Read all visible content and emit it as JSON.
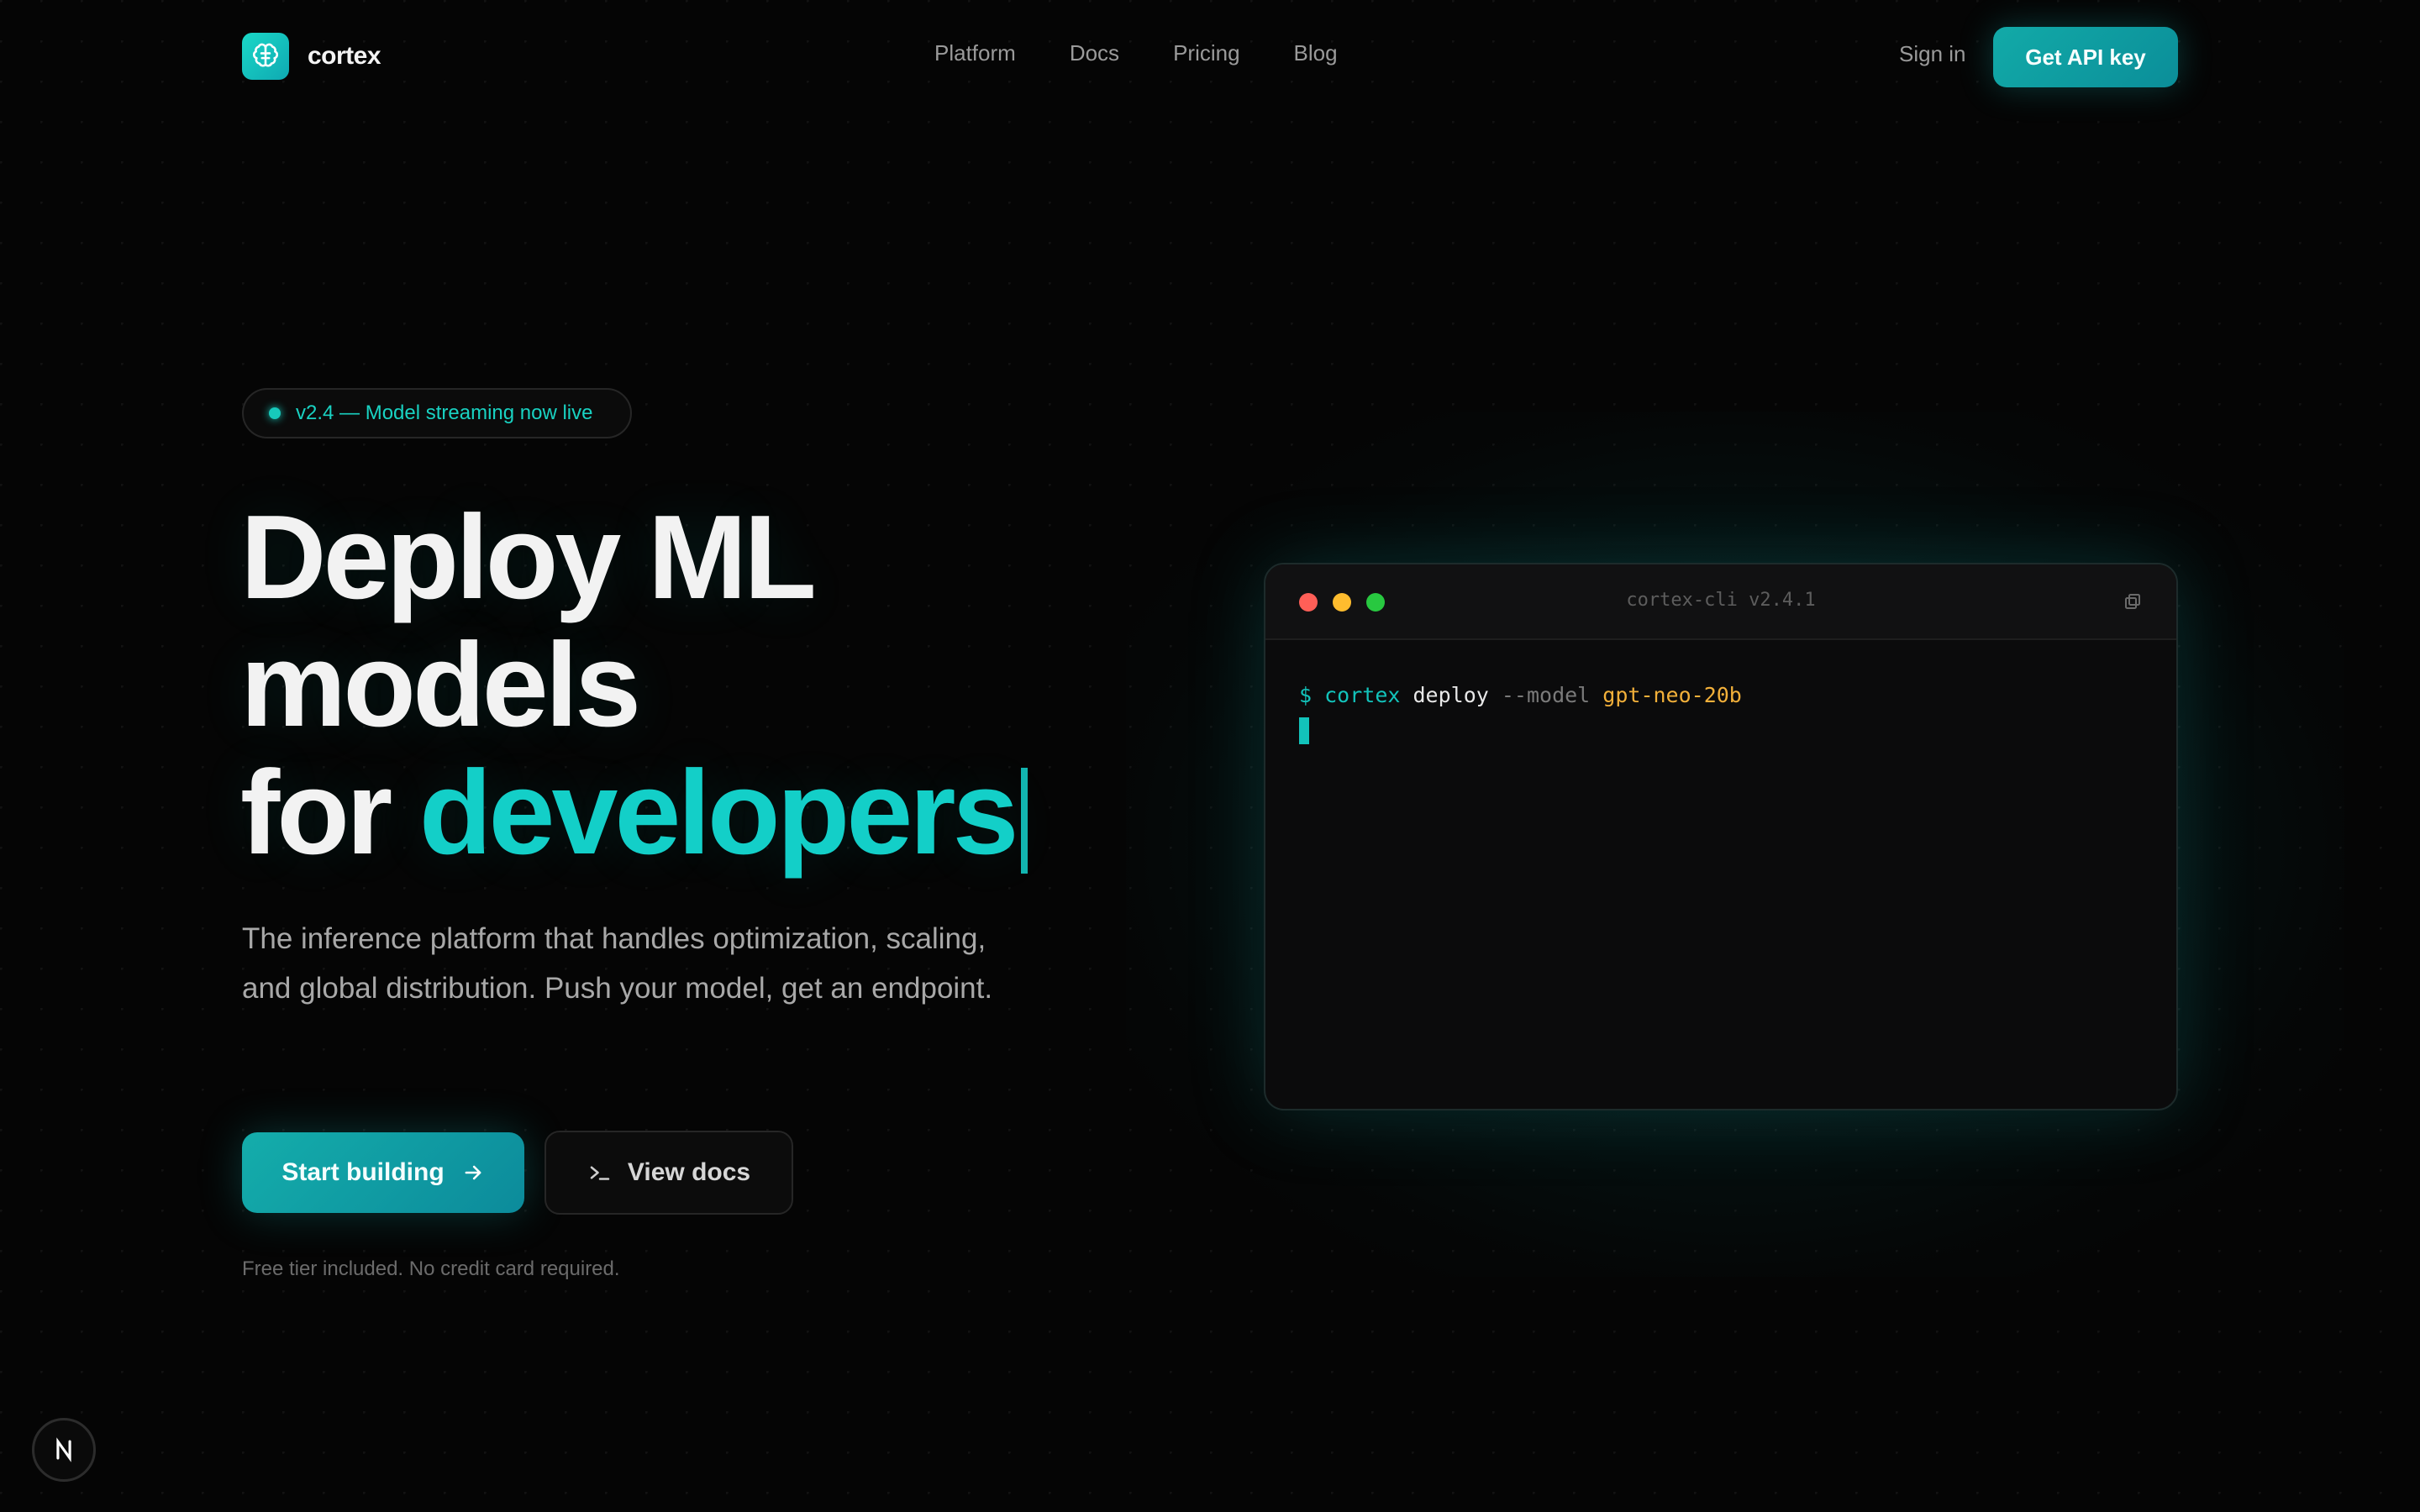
{
  "brand": {
    "name": "cortex",
    "logo_icon": "brain-icon",
    "accent": "#13cfc8"
  },
  "nav": {
    "links": [
      "Platform",
      "Docs",
      "Pricing",
      "Blog"
    ],
    "sign_in": "Sign in",
    "api_key": "Get API key"
  },
  "hero": {
    "badge": "v2.4 — Model streaming now live",
    "headline_line1": "Deploy ML",
    "headline_line2": "models",
    "headline_line3_prefix": "for ",
    "headline_line3_accent": "developers",
    "subtitle": "The inference platform that handles optimization, scaling, and global distribution. Push your model, get an endpoint.",
    "cta_primary": "Start building",
    "cta_secondary": "View docs",
    "fine_print": "Free tier included. No credit card required."
  },
  "terminal": {
    "title": "cortex-cli v2.4.1",
    "prompt": "$",
    "command": "cortex",
    "subcommand": "deploy",
    "flag": "--model",
    "value": "gpt-neo-20b",
    "traffic_colors": [
      "#ff5f57",
      "#febc2e",
      "#28c840"
    ]
  },
  "corner_badge": {
    "letter": "N"
  }
}
